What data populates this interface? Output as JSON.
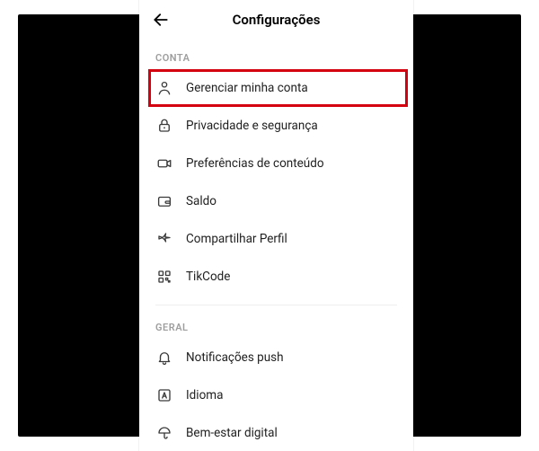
{
  "header": {
    "title": "Configurações"
  },
  "sections": {
    "conta": {
      "label": "CONTA",
      "items": {
        "manage_account": "Gerenciar minha conta",
        "privacy": "Privacidade e segurança",
        "content_prefs": "Preferências de conteúdo",
        "balance": "Saldo",
        "share_profile": "Compartilhar Perfil",
        "tikcode": "TikCode"
      }
    },
    "geral": {
      "label": "GERAL",
      "items": {
        "push_notifications": "Notificações push",
        "language": "Idioma",
        "digital_wellbeing": "Bem-estar digital"
      }
    }
  }
}
